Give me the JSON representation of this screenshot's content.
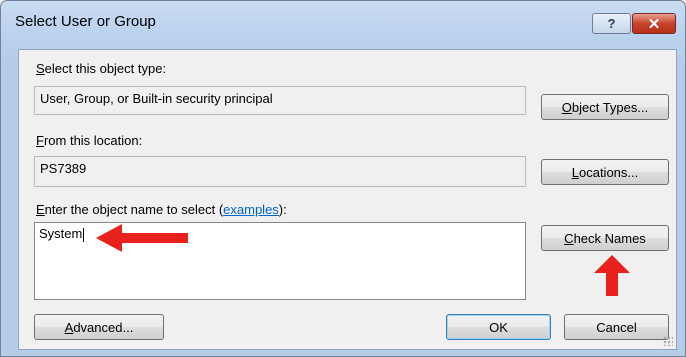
{
  "window": {
    "title": "Select User or Group",
    "help_button": "?",
    "close_button": "✕"
  },
  "object_type": {
    "label_prefix": "",
    "label_underlined": "S",
    "label_rest": "elect this object type:",
    "value": "User, Group, or Built-in security principal",
    "button_underlined": "O",
    "button_rest": "bject Types..."
  },
  "location": {
    "label_underlined": "F",
    "label_rest": "rom this location:",
    "value": "PS7389",
    "button_underlined": "L",
    "button_rest": "ocations..."
  },
  "object_name": {
    "label_underlined": "E",
    "label_rest": "nter the object name to select (",
    "link": "examples",
    "label_end": "):",
    "value": "System",
    "check_names_underlined": "C",
    "check_names_rest": "heck Names"
  },
  "footer": {
    "advanced_underlined": "A",
    "advanced_rest": "dvanced...",
    "ok": "OK",
    "cancel": "Cancel"
  },
  "annotations": {
    "arrow_color": "#e8211c"
  }
}
